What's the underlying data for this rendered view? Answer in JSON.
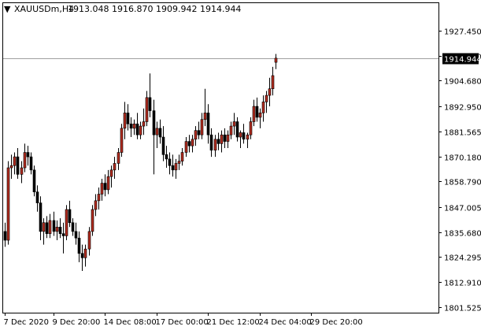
{
  "window": {
    "symbol_label": "XAUUSDm,H4",
    "ohlc_label": "1913.048 1916.870 1909.942 1914.944",
    "menu_glyph": "▼"
  },
  "colors": {
    "background": "#ffffff",
    "frame": "#000000",
    "bull_fill": "#b22b1e",
    "bear_fill": "#000000",
    "bid_line": "#a0a0a0",
    "price_tag_bg": "#000000",
    "price_tag_text": "#ffffff"
  },
  "chart_data": {
    "type": "candlestick",
    "symbol": "XAUUSDm",
    "timeframe": "H4",
    "current_price": 1914.944,
    "ylim": [
      1799.0,
      1940.0
    ],
    "y_ticks": [
      "1927.450",
      "1916.050",
      "1904.680",
      "1892.950",
      "1881.565",
      "1870.180",
      "1858.790",
      "1847.005",
      "1835.680",
      "1824.295",
      "1812.910",
      "1801.525"
    ],
    "y_tick_values": [
      1927.45,
      1916.05,
      1904.68,
      1892.95,
      1881.565,
      1870.18,
      1858.79,
      1847.005,
      1835.68,
      1824.295,
      1812.91,
      1801.525
    ],
    "x_ticks": [
      {
        "label": "7 Dec 2020",
        "index": 0
      },
      {
        "label": "9 Dec 20:00",
        "index": 15
      },
      {
        "label": "14 Dec 08:00",
        "index": 31
      },
      {
        "label": "17 Dec 00:00",
        "index": 47
      },
      {
        "label": "21 Dec 12:00",
        "index": 63
      },
      {
        "label": "24 Dec 04:00",
        "index": 79
      },
      {
        "label": "29 Dec 20:00",
        "index": 95
      }
    ],
    "candles": [
      [
        1836,
        1840,
        1829,
        1832
      ],
      [
        1832,
        1868,
        1830,
        1865
      ],
      [
        1865,
        1871,
        1860,
        1866
      ],
      [
        1866,
        1872,
        1862,
        1870
      ],
      [
        1870,
        1874,
        1860,
        1862
      ],
      [
        1862,
        1868,
        1858,
        1865
      ],
      [
        1865,
        1876,
        1863,
        1872
      ],
      [
        1872,
        1875,
        1866,
        1870
      ],
      [
        1870,
        1872,
        1862,
        1864
      ],
      [
        1864,
        1866,
        1852,
        1854
      ],
      [
        1854,
        1857,
        1845,
        1849
      ],
      [
        1849,
        1852,
        1832,
        1836
      ],
      [
        1836,
        1842,
        1830,
        1840
      ],
      [
        1840,
        1843,
        1833,
        1835
      ],
      [
        1835,
        1844,
        1833,
        1841
      ],
      [
        1841,
        1845,
        1834,
        1836
      ],
      [
        1836,
        1841,
        1832,
        1838
      ],
      [
        1838,
        1842,
        1833,
        1835
      ],
      [
        1835,
        1840,
        1826,
        1834
      ],
      [
        1834,
        1848,
        1832,
        1846
      ],
      [
        1846,
        1850,
        1838,
        1840
      ],
      [
        1840,
        1842,
        1834,
        1836
      ],
      [
        1836,
        1840,
        1830,
        1833
      ],
      [
        1833,
        1836,
        1822,
        1826
      ],
      [
        1826,
        1830,
        1818,
        1824
      ],
      [
        1824,
        1830,
        1820,
        1828
      ],
      [
        1828,
        1838,
        1825,
        1836
      ],
      [
        1836,
        1848,
        1834,
        1846
      ],
      [
        1846,
        1853,
        1843,
        1850
      ],
      [
        1850,
        1856,
        1846,
        1853
      ],
      [
        1853,
        1860,
        1850,
        1858
      ],
      [
        1858,
        1862,
        1852,
        1855
      ],
      [
        1855,
        1864,
        1853,
        1861
      ],
      [
        1861,
        1866,
        1856,
        1864
      ],
      [
        1864,
        1870,
        1860,
        1867
      ],
      [
        1867,
        1874,
        1864,
        1872
      ],
      [
        1872,
        1885,
        1870,
        1883
      ],
      [
        1883,
        1895,
        1878,
        1890
      ],
      [
        1890,
        1894,
        1882,
        1885
      ],
      [
        1885,
        1888,
        1879,
        1883
      ],
      [
        1883,
        1887,
        1880,
        1885
      ],
      [
        1885,
        1890,
        1878,
        1880
      ],
      [
        1880,
        1886,
        1878,
        1884
      ],
      [
        1884,
        1892,
        1880,
        1886
      ],
      [
        1886,
        1900,
        1884,
        1897
      ],
      [
        1897,
        1908,
        1888,
        1891
      ],
      [
        1891,
        1896,
        1862,
        1880
      ],
      [
        1880,
        1886,
        1874,
        1883
      ],
      [
        1883,
        1887,
        1876,
        1879
      ],
      [
        1879,
        1884,
        1868,
        1871
      ],
      [
        1871,
        1875,
        1865,
        1869
      ],
      [
        1869,
        1872,
        1862,
        1866
      ],
      [
        1866,
        1871,
        1861,
        1864
      ],
      [
        1864,
        1869,
        1860,
        1867
      ],
      [
        1867,
        1871,
        1864,
        1868
      ],
      [
        1868,
        1874,
        1866,
        1872
      ],
      [
        1872,
        1879,
        1870,
        1877
      ],
      [
        1877,
        1880,
        1872,
        1875
      ],
      [
        1875,
        1880,
        1872,
        1878
      ],
      [
        1878,
        1884,
        1875,
        1882
      ],
      [
        1882,
        1886,
        1878,
        1880
      ],
      [
        1880,
        1890,
        1878,
        1887
      ],
      [
        1887,
        1901,
        1884,
        1890
      ],
      [
        1890,
        1894,
        1876,
        1880
      ],
      [
        1880,
        1883,
        1870,
        1873
      ],
      [
        1873,
        1880,
        1870,
        1878
      ],
      [
        1878,
        1881,
        1873,
        1876
      ],
      [
        1876,
        1882,
        1872,
        1880
      ],
      [
        1880,
        1883,
        1874,
        1877
      ],
      [
        1877,
        1882,
        1874,
        1880
      ],
      [
        1880,
        1886,
        1878,
        1884
      ],
      [
        1884,
        1890,
        1880,
        1886
      ],
      [
        1886,
        1888,
        1877,
        1879
      ],
      [
        1879,
        1882,
        1874,
        1881
      ],
      [
        1881,
        1885,
        1876,
        1878
      ],
      [
        1878,
        1881,
        1874,
        1880
      ],
      [
        1880,
        1888,
        1878,
        1886
      ],
      [
        1886,
        1896,
        1884,
        1893
      ],
      [
        1893,
        1897,
        1886,
        1888
      ],
      [
        1888,
        1892,
        1883,
        1890
      ],
      [
        1890,
        1898,
        1886,
        1895
      ],
      [
        1895,
        1900,
        1890,
        1898
      ],
      [
        1898,
        1906,
        1893,
        1901
      ],
      [
        1901,
        1911,
        1898,
        1907
      ],
      [
        1913.048,
        1916.87,
        1909.942,
        1914.944
      ]
    ]
  }
}
